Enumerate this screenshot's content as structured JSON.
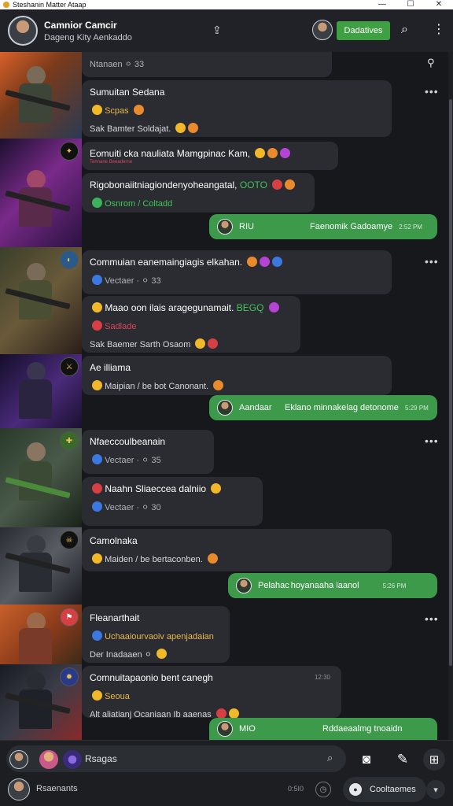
{
  "window": {
    "title": "Steshanin Matter Ataap",
    "minimize": "—",
    "maximize": "☐",
    "close": "✕"
  },
  "header": {
    "name": "Camnior Camcir",
    "subtitle": "Dageng Kity Aenkaddo",
    "share_icon": "share-icon",
    "action_button": "Dadatives",
    "search_icon": "search-icon",
    "more_icon": "more-vertical-icon"
  },
  "feed": {
    "top_user_icon": "user-icon",
    "posts": [
      {
        "meta": "Ntanaen ⚪ 33"
      },
      {
        "title": "Sumuitan Sedana",
        "line1": "Scpas",
        "line2": "Sak   Bamter  Soldajat."
      },
      {
        "title": "Eomuiti cka nauliata Mamgpinac Kam,",
        "tag": "Tennane Beeaderne"
      },
      {
        "text": "Rigobonaiitniagiondenyoheangatal,",
        "highlight": "OOTO",
        "line2": "Osnrom / Coltadd"
      },
      {
        "bubble_name": "RIU",
        "bubble_text": "Faenomik Gadoamye",
        "bubble_time": "2:52 PM"
      },
      {
        "title": "Commuian eanemaingiagis elkahan.",
        "line1": "Vectaer · ⚪ 33"
      },
      {
        "title": "Maao oon ilais aragegunamait.",
        "highlight": "BEGQ",
        "line1": "Sadlade",
        "line2": "Sak  Baemer  Sarth  Osaom"
      },
      {
        "title": "Ae illiama",
        "line1": "Maipian / be bot Canonant."
      },
      {
        "bubble_name": "Aandaar",
        "bubble_text": "Eklano minnakelag  detonome",
        "bubble_time": "5:29 PM"
      },
      {
        "title": "Nfaeccoulbeanain",
        "line1": "Vectaer · ⚪ 35"
      },
      {
        "title": "Naahn Sliaeccea dalniio",
        "line1": "Vectaer · ⚪ 30"
      },
      {
        "title": "Camolnaka",
        "line1": "Maiden / be bertaconben."
      },
      {
        "bubble_name": "Pelahac",
        "bubble_text": "hoyanaaha laanol",
        "bubble_time": "5:26 PM"
      },
      {
        "title": "Fleanarthait",
        "line1": "Uchaaiourvaoiv apenjadaian",
        "line2": "Der Inadaaen ⚪"
      },
      {
        "title": "Comnuitapaonio bent canegh",
        "time": "12:30",
        "line1": "Seoua",
        "line2": "Alt aliatianj   Ocaniaan  Ib  aaenas"
      },
      {
        "bubble_name": "MIO",
        "bubble_text": "Rddaeaalmg tnoaidn",
        "bubble_time": ""
      }
    ]
  },
  "composer": {
    "input_text": "Rsagas",
    "attach_icon": "pin-icon",
    "camera_icon": "camera-icon",
    "sticker_icon": "sticker-icon",
    "add_icon": "add-icon",
    "recent_name": "Rsaenants",
    "recent_time": "0:5I0",
    "chip_label": "Cooltaemes",
    "colors": {
      "accent": "#3fa043",
      "background": "#16181c",
      "card": "#2a2c31"
    }
  }
}
